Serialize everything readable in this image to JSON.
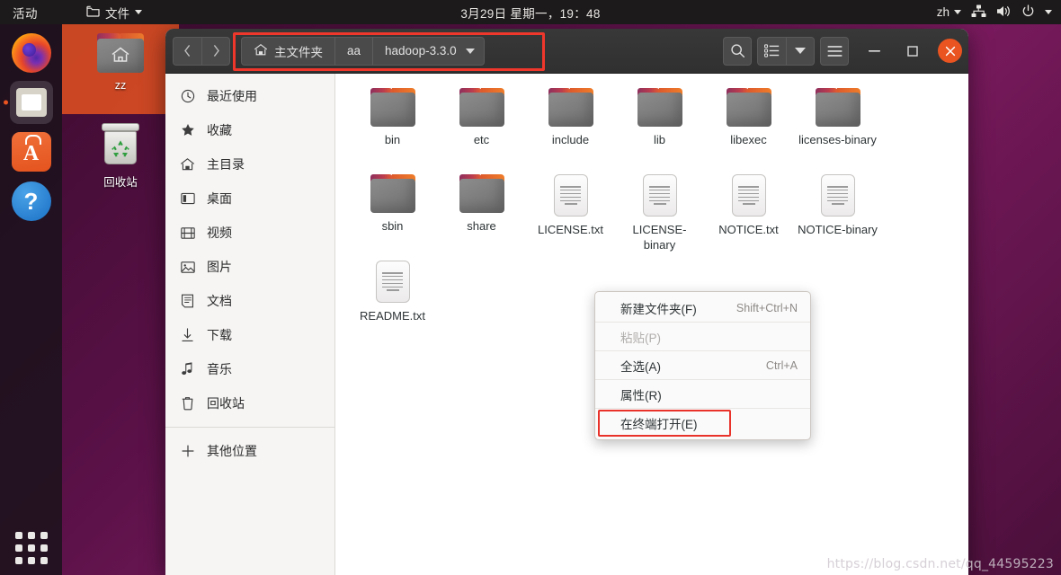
{
  "topbar": {
    "activities": "活动",
    "files_menu": "文件",
    "files_icon": "folder-icon",
    "clock": "3月29日 星期一，19：48",
    "language": "zh",
    "icons": [
      "network-icon",
      "volume-icon",
      "power-icon",
      "chevron-down-icon"
    ]
  },
  "dock": {
    "items": [
      {
        "name": "firefox",
        "icon": "firefox-icon",
        "active": false
      },
      {
        "name": "files",
        "icon": "files-icon",
        "active": true
      },
      {
        "name": "ubuntu-software",
        "icon": "ubuntu-software-icon",
        "active": false
      },
      {
        "name": "help",
        "icon": "help-icon",
        "active": false
      }
    ],
    "show_apps": "show-applications-icon"
  },
  "desktop": {
    "icons": [
      {
        "label": "zz",
        "icon": "home-folder-icon",
        "selected": true
      },
      {
        "label": "回收站",
        "icon": "trash-icon",
        "selected": false
      }
    ]
  },
  "window": {
    "nav": {
      "back": "back-icon",
      "forward": "forward-icon"
    },
    "breadcrumbs": [
      {
        "label": "主文件夹",
        "icon": "home-icon",
        "has_caret": false
      },
      {
        "label": "aa",
        "icon": "",
        "has_caret": false
      },
      {
        "label": "hadoop-3.3.0",
        "icon": "",
        "has_caret": true
      }
    ],
    "header_buttons": [
      {
        "name": "search-button",
        "icon": "search-icon"
      },
      {
        "name": "view-list-button",
        "icon": "list-view-icon"
      },
      {
        "name": "view-options-button",
        "icon": "chevron-down-icon"
      },
      {
        "name": "main-menu-button",
        "icon": "hamburger-icon"
      }
    ],
    "controls": [
      {
        "name": "minimize-button",
        "icon": "minimize-icon"
      },
      {
        "name": "maximize-button",
        "icon": "maximize-icon"
      },
      {
        "name": "close-button",
        "icon": "close-icon"
      }
    ]
  },
  "sidebar": {
    "items": [
      {
        "label": "最近使用",
        "icon": "clock-icon"
      },
      {
        "label": "收藏",
        "icon": "star-icon"
      },
      {
        "label": "主目录",
        "icon": "home-icon"
      },
      {
        "label": "桌面",
        "icon": "desktop-icon"
      },
      {
        "label": "视频",
        "icon": "video-icon"
      },
      {
        "label": "图片",
        "icon": "image-icon"
      },
      {
        "label": "文档",
        "icon": "document-icon"
      },
      {
        "label": "下载",
        "icon": "download-icon"
      },
      {
        "label": "音乐",
        "icon": "music-icon"
      },
      {
        "label": "回收站",
        "icon": "trash-icon"
      }
    ],
    "other_locations": {
      "label": "其他位置",
      "icon": "plus-icon"
    }
  },
  "files": [
    {
      "name": "bin",
      "type": "folder"
    },
    {
      "name": "etc",
      "type": "folder"
    },
    {
      "name": "include",
      "type": "folder"
    },
    {
      "name": "lib",
      "type": "folder"
    },
    {
      "name": "libexec",
      "type": "folder"
    },
    {
      "name": "licenses-binary",
      "type": "folder"
    },
    {
      "name": "sbin",
      "type": "folder"
    },
    {
      "name": "share",
      "type": "folder"
    },
    {
      "name": "LICENSE.txt",
      "type": "text"
    },
    {
      "name": "LICENSE-binary",
      "type": "text"
    },
    {
      "name": "NOTICE.txt",
      "type": "text"
    },
    {
      "name": "NOTICE-binary",
      "type": "text"
    },
    {
      "name": "README.txt",
      "type": "text"
    }
  ],
  "context_menu": {
    "items": [
      {
        "label": "新建文件夹(F)",
        "accel": "Shift+Ctrl+N",
        "disabled": false,
        "highlighted": false
      },
      {
        "label": "粘贴(P)",
        "accel": "",
        "disabled": true,
        "highlighted": false
      },
      {
        "label": "全选(A)",
        "accel": "Ctrl+A",
        "disabled": false,
        "highlighted": false
      },
      {
        "label": "属性(R)",
        "accel": "",
        "disabled": false,
        "highlighted": false
      },
      {
        "label": "在终端打开(E)",
        "accel": "",
        "disabled": false,
        "highlighted": true
      }
    ]
  },
  "annotations": {
    "path_box_color": "#f0372c",
    "menu_item_box_color": "#e8322a"
  },
  "watermark": "https://blog.csdn.net/qq_44595223"
}
